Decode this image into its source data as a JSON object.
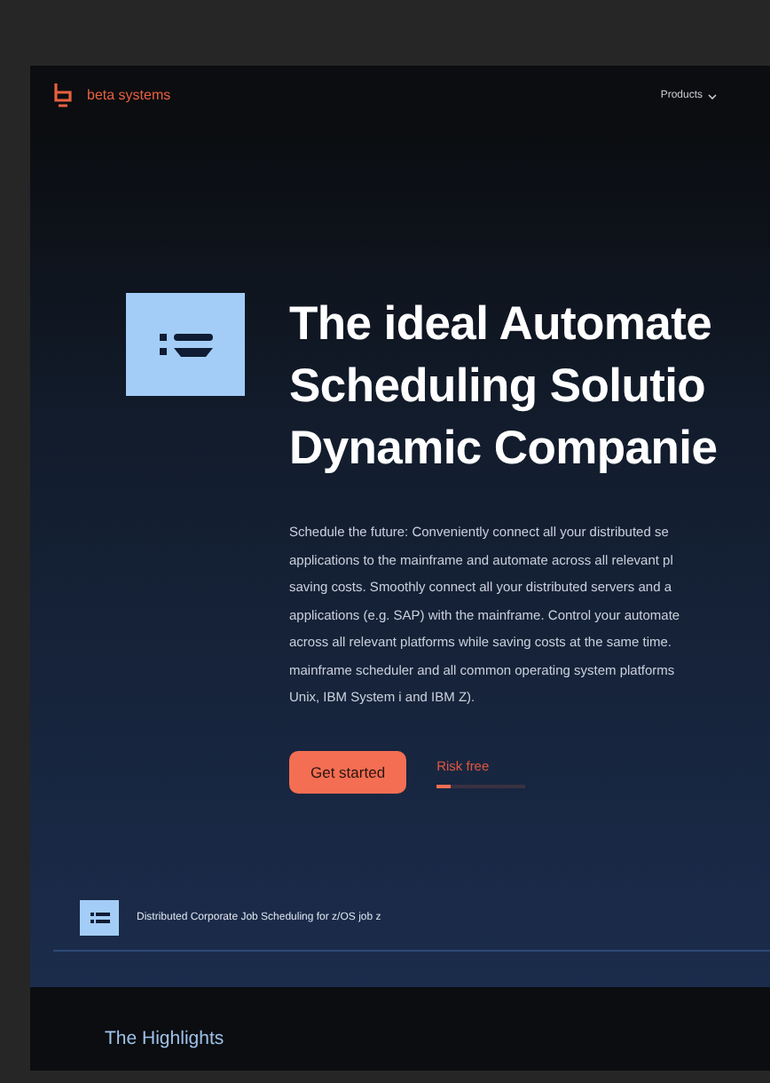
{
  "navbar": {
    "brand": "beta systems",
    "menu": [
      {
        "label": "Products",
        "dropdown": true
      }
    ]
  },
  "hero": {
    "headline": [
      "The ideal Automate",
      "Scheduling Solutio",
      "Dynamic Companie"
    ],
    "paragraph": [
      "Schedule the future: Conveniently connect all your distributed se",
      "applications to the mainframe and automate across all relevant pl",
      "saving costs. Smoothly connect all your distributed servers and a",
      "applications (e.g. SAP) with the mainframe. Control your automate",
      "across all relevant platforms while saving costs at the same time.",
      "mainframe scheduler and all common operating system platforms",
      "Unix, IBM System i and IBM Z)."
    ],
    "primary_button": "Get started",
    "secondary_link": {
      "label": "Risk free",
      "level": 0.15
    }
  },
  "product_strip": {
    "label": "Distributed Corporate Job Scheduling for z/OS job z"
  },
  "section_heading": "The Highlights"
}
